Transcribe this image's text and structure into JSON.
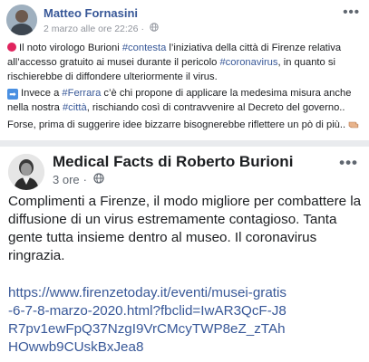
{
  "post1": {
    "author": "Matteo Fornasini",
    "timestamp": "2 marzo alle ore 22:26",
    "para1": {
      "t1": "Il noto virologo Burioni ",
      "h1": "#contesta",
      "t2": " l’iniziativa della città di Firenze relativa all’accesso gratuito ai musei durante il pericolo ",
      "h2": "#coronavirus",
      "t3": ", in quanto si rischierebbe di diffondere ulteriormente il virus."
    },
    "para2": {
      "t1": "Invece a ",
      "h1": "#Ferrara",
      "t2": " c’è chi propone di applicare la medesima misura anche nella nostra ",
      "h2": "#città",
      "t3": ", rischiando così di contravvenire al Decreto del governo.."
    },
    "para3": "Forse, prima di suggerire idee bizzarre bisognerebbe riflettere un pò di più.."
  },
  "post2": {
    "author": "Medical Facts di Roberto Burioni",
    "timestamp": "3 ore",
    "body": "Complimenti a Firenze, il modo migliore per combattere la diffusione di un virus estremamente contagioso. Tanta gente tutta insieme dentro al museo. Il coronavirus ringrazia.",
    "link": "https://www.firenzetoday.it/eventi/musei-gratis-6-7-8-marzo-2020.html?fbclid=IwAR3QcF-J8R7pv1ewFpQ37NzgI9VrCMcyTWP8eZ_zTAhHOwwb9CUskBxJea8"
  },
  "more_label": "•••",
  "meta_sep": "·",
  "icons": {
    "privacy": "globe-icon",
    "alert": "red-circle-icon",
    "arrow": "right-arrow-icon",
    "hand": "pointing-hand-icon",
    "options": "more-options-icon"
  },
  "colors": {
    "link": "#385898",
    "text": "#1c1e21",
    "meta": "#90949c",
    "separator": "#e9ebee"
  }
}
